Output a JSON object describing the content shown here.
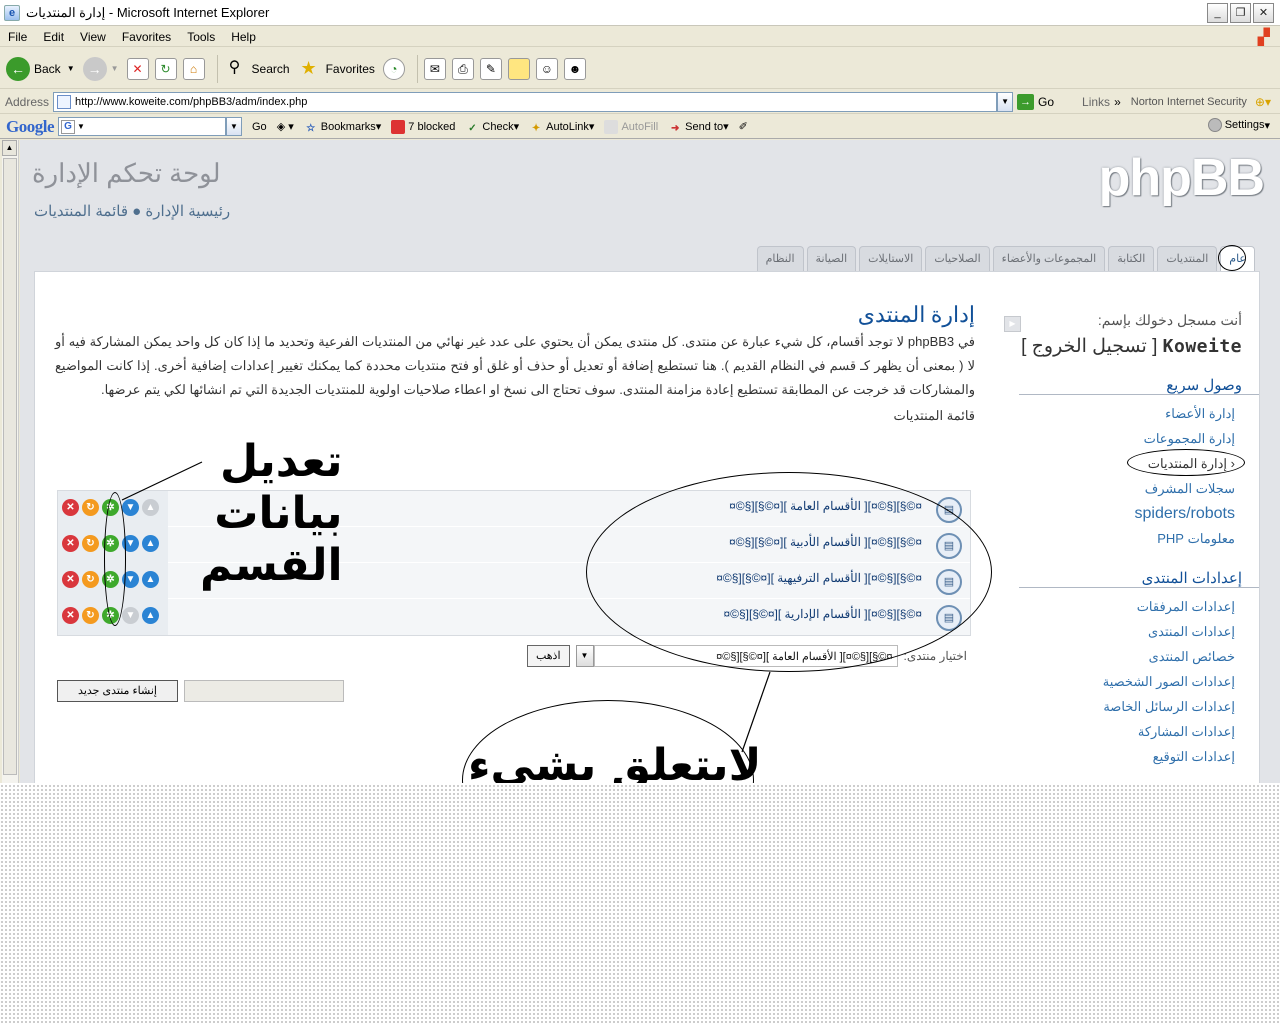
{
  "window": {
    "title": "إدارة المنتديات - Microsoft Internet Explorer",
    "buttons": [
      "_",
      "❐",
      "✕"
    ]
  },
  "menu": [
    "File",
    "Edit",
    "View",
    "Favorites",
    "Tools",
    "Help"
  ],
  "toolbar": {
    "back": "Back",
    "search": "Search",
    "favorites": "Favorites"
  },
  "address": {
    "label": "Address",
    "url": "http://www.koweite.com/phpBB3/adm/index.php",
    "go": "Go",
    "links": "Links",
    "norton": "Norton Internet Security"
  },
  "google": {
    "logo": "Google",
    "go": "Go",
    "bookmarks": "Bookmarks",
    "blocked": "7 blocked",
    "check": "Check",
    "autolink": "AutoLink",
    "autofill": "AutoFill",
    "sendto": "Send to",
    "settings": "Settings"
  },
  "page": {
    "title": "لوحة تحكم الإدارة",
    "breadcrumb": "رئيسية الإدارة ● قائمة المنتديات",
    "logo": "phpBB",
    "tabs": [
      "عام",
      "المنتديات",
      "الكتابة",
      "المجموعات والأعضاء",
      "الصلاحيات",
      "الاستايلات",
      "الصيانة",
      "النظام"
    ]
  },
  "sidebar": {
    "logged_in": "أنت مسجل دخولك بإسم:",
    "username": "Koweite",
    "logout": "[ تسجيل الخروج ]",
    "quick_access": "وصول سريع",
    "quick_items": [
      "إدارة الأعضاء",
      "إدارة المجموعات",
      "إدارة المنتديات",
      "سجلات المشرف",
      "spiders/robots",
      "معلومات PHP"
    ],
    "forum_settings": "إعدادات المنتدى",
    "settings_items": [
      "إعدادات المرفقات",
      "إعدادات المنتدى",
      "خصائص المنتدى",
      "إعدادات الصور الشخصية",
      "إعدادات الرسائل الخاصة",
      "إعدادات المشاركة",
      "إعدادات التوقيع"
    ]
  },
  "main": {
    "heading": "إدارة المنتدى",
    "description": "في phpBB3 لا توجد أقسام، كل شيء عبارة عن منتدى. كل منتدى يمكن أن يحتوي على عدد غير نهائي من المنتديات الفرعية وتحديد ما إذا كان كل واحد يمكن المشاركة فيه أو لا ( بمعنى أن يظهر كـ قسم في النظام القديم ). هنا تستطيع إضافة أو تعديل أو حذف أو غلق أو فتح منتديات محددة كما يمكنك تغيير إعدادات إضافية أخرى. إذا كانت المواضيع والمشاركات قد خرجت عن المطابقة تستطيع إعادة مزامنة المنتدى. سوف تحتاج الى نسخ او اعطاء صلاحيات اولوية للمنتديات الجديدة التي تم انشائها لكي يتم عرضها.",
    "list_title": "قائمة المنتديات",
    "forums": [
      "¤©§][§©¤][ الأقسام العامة ][¤©§][§©¤",
      "¤©§][§©¤][ الأقسام الأدبية ][¤©§][§©¤",
      "¤©§][§©¤][ الأقسام الترفيهية ][¤©§][§©¤",
      "¤©§][§©¤][ الأقسام الإدارية ][¤©§][§©¤"
    ],
    "jump_label": "اختيار منتدى:",
    "jump_value": "¤©§][§©¤][ الأقسام العامة ][¤©§][§©¤",
    "go_button": "اذهب",
    "create_button": "إنشاء منتدى جديد"
  },
  "annotations": {
    "edit_note": [
      "تعديل",
      "بيانات",
      "القسم"
    ],
    "bottom_note": "لايتعلق بشيء"
  }
}
